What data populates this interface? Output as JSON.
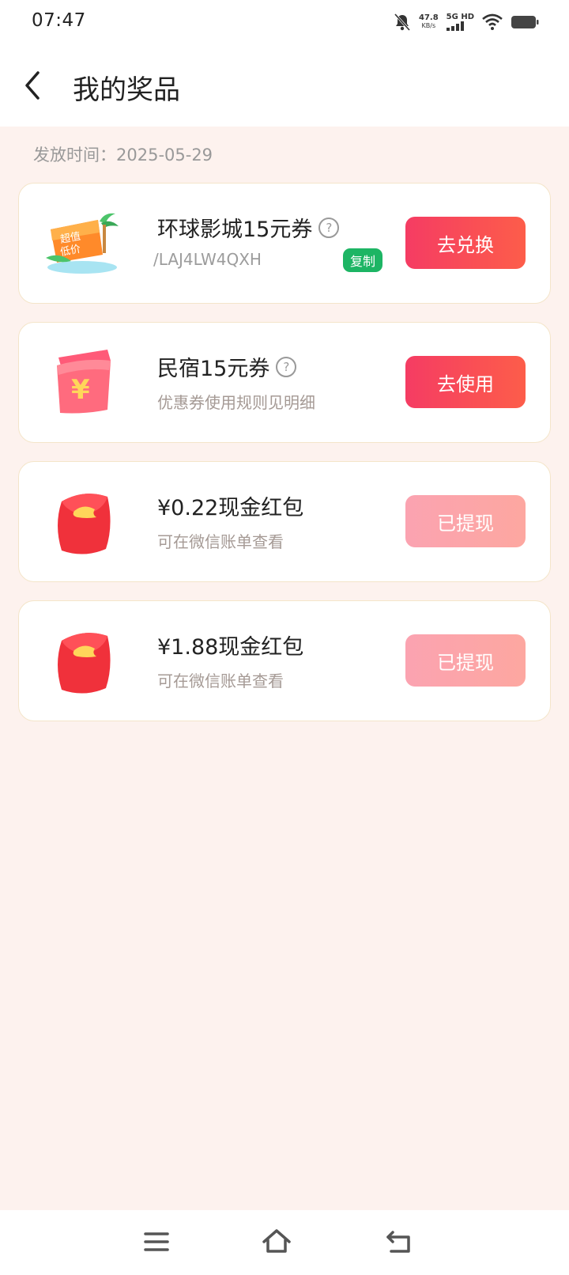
{
  "status": {
    "time": "07:47",
    "net_speed": "47.8",
    "net_unit": "KB/s",
    "network": "5G HD"
  },
  "header": {
    "title": "我的奖品"
  },
  "issue_date": "发放时间：2025-05-29",
  "prizes": [
    {
      "title": "环球影城15元券",
      "has_help": true,
      "code": "/LAJ4LW4QXH",
      "copy_label": "复制",
      "action": "去兑换",
      "state": "active",
      "icon": "discount-ticket-icon"
    },
    {
      "title": "民宿15元券",
      "has_help": true,
      "subtitle": "优惠券使用规则见明细",
      "action": "去使用",
      "state": "active",
      "icon": "yuan-coupon-icon"
    },
    {
      "title": "¥0.22现金红包",
      "subtitle": "可在微信账单查看",
      "action": "已提现",
      "state": "done",
      "icon": "red-envelope-icon"
    },
    {
      "title": "¥1.88现金红包",
      "subtitle": "可在微信账单查看",
      "action": "已提现",
      "state": "done",
      "icon": "red-envelope-icon"
    }
  ],
  "colors": {
    "background": "#fdf2ee",
    "accent": "#f53c63",
    "copy_green": "#1db564",
    "done_pink": "#fba3b1"
  },
  "nav": [
    "menu-icon",
    "home-icon",
    "back-icon"
  ]
}
